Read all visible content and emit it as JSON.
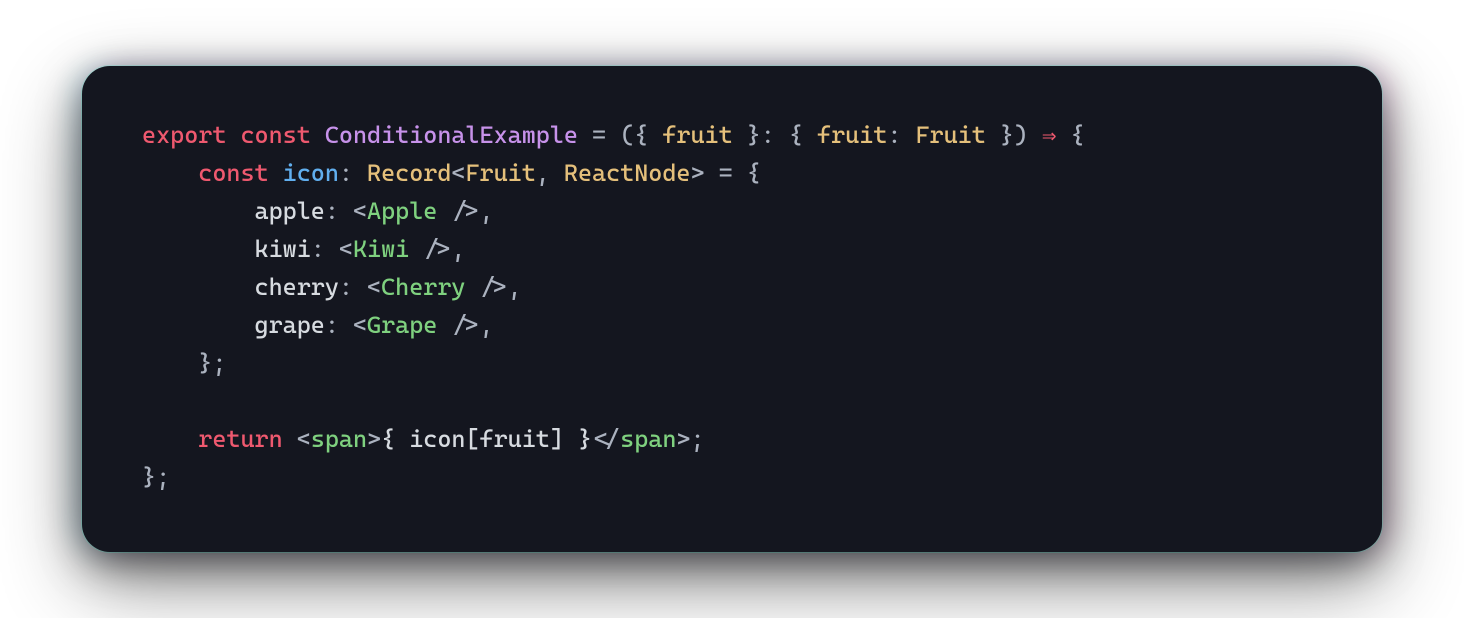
{
  "code": {
    "line1": {
      "export": "export",
      "const": "const",
      "fn": "ConditionalExample",
      "eq": " = ",
      "lp1": "(",
      "lb1": "{",
      "sp1": " ",
      "prop": "fruit",
      "sp2": " ",
      "rb1": "}",
      "colon1": ": ",
      "lb2": "{",
      "sp3": " ",
      "propKey": "fruit",
      "colon2": ": ",
      "propType": "Fruit",
      "sp4": " ",
      "rb2": "}",
      "rp1": ")",
      "sp5": " ",
      "arrow": "⇒",
      "sp6": " ",
      "lb3": "{"
    },
    "line2": {
      "indent": "    ",
      "const": "const",
      "sp1": " ",
      "var": "icon",
      "colon": ": ",
      "recType": "Record",
      "lt": "<",
      "t1": "Fruit",
      "comma": ", ",
      "t2": "ReactNode",
      "gt": ">",
      "eq": " = ",
      "lb": "{"
    },
    "line3": {
      "indent": "        ",
      "key": "apple",
      "col": ": ",
      "lt": "<",
      "comp": "Apple",
      "sp": " ",
      "sl": "/>",
      "comma": ","
    },
    "line4": {
      "indent": "        ",
      "key": "kiwi",
      "col": ": ",
      "lt": "<",
      "comp": "Kiwi",
      "sp": " ",
      "sl": "/>",
      "comma": ","
    },
    "line5": {
      "indent": "        ",
      "key": "cherry",
      "col": ": ",
      "lt": "<",
      "comp": "Cherry",
      "sp": " ",
      "sl": "/>",
      "comma": ","
    },
    "line6": {
      "indent": "        ",
      "key": "grape",
      "col": ": ",
      "lt": "<",
      "comp": "Grape",
      "sp": " ",
      "sl": "/>",
      "comma": ","
    },
    "line7": {
      "indent": "    ",
      "rb": "}",
      "semi": ";"
    },
    "line8": {
      "blank": ""
    },
    "line9": {
      "indent": "    ",
      "return": "return",
      "sp1": " ",
      "lt1": "<",
      "tag": "span",
      "gt1": ">",
      "expr": "{ icon[fruit] }",
      "lt2": "</",
      "tag2": "span",
      "gt2": ">",
      "semi": ";"
    },
    "line10": {
      "rb": "}",
      "semi": ";"
    }
  }
}
